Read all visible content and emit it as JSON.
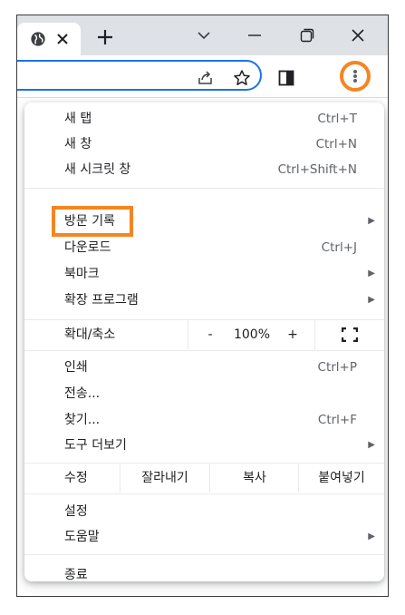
{
  "menu": {
    "new_tab": {
      "label": "새 탭",
      "shortcut": "Ctrl+T"
    },
    "new_window": {
      "label": "새 창",
      "shortcut": "Ctrl+N"
    },
    "incognito": {
      "label": "새 시크릿 창",
      "shortcut": "Ctrl+Shift+N"
    },
    "history": {
      "label": "방문 기록"
    },
    "downloads": {
      "label": "다운로드",
      "shortcut": "Ctrl+J"
    },
    "bookmarks": {
      "label": "북마크"
    },
    "extensions": {
      "label": "확장 프로그램"
    },
    "zoom": {
      "label": "확대/축소",
      "minus": "-",
      "value": "100%",
      "plus": "+"
    },
    "print": {
      "label": "인쇄",
      "shortcut": "Ctrl+P"
    },
    "cast": {
      "label": "전송..."
    },
    "find": {
      "label": "찾기...",
      "shortcut": "Ctrl+F"
    },
    "more_tools": {
      "label": "도구 더보기"
    },
    "edit": {
      "label": "수정",
      "cut": "잘라내기",
      "copy": "복사",
      "paste": "붙여넣기"
    },
    "settings": {
      "label": "설정"
    },
    "help": {
      "label": "도움말"
    },
    "exit": {
      "label": "종료"
    },
    "submenu_arrow": "▶"
  },
  "colors": {
    "highlight": "#f58520",
    "accent": "#1a73e8",
    "tabstrip": "#dee1e6"
  },
  "icons": [
    "globe-icon",
    "close-icon",
    "plus-icon",
    "chevron-down-icon",
    "minimize-icon",
    "restore-icon",
    "share-icon",
    "star-icon",
    "side-panel-icon",
    "more-vert-icon",
    "fullscreen-icon"
  ]
}
